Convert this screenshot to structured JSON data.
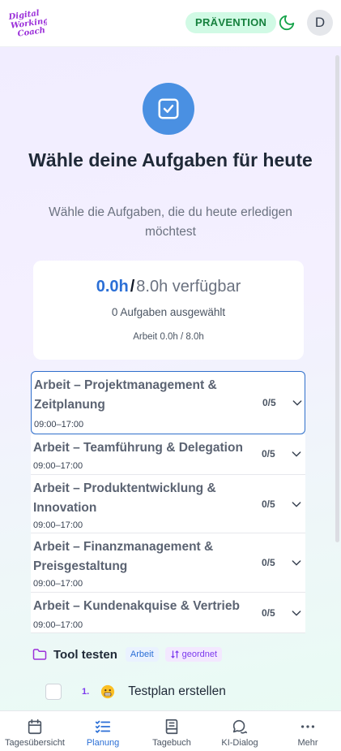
{
  "header": {
    "logo_text": [
      "Digital",
      "Working",
      "Coach"
    ],
    "mode_badge": "PRÄVENTION",
    "avatar_initial": "D"
  },
  "hero": {
    "title": "Wähle deine Aufgaben für heute",
    "subtitle": "Wähle die Aufgaben, die du heute erledigen möchtest"
  },
  "summary": {
    "used": "0.0h",
    "slash": "/",
    "available": "8.0h verfügbar",
    "selected": "0 Aufgaben ausgewählt",
    "budget": "Arbeit 0.0h / 8.0h"
  },
  "categories": [
    {
      "title": "Arbeit – Projektmanagement & Zeitplanung",
      "time": "09:00–17:00",
      "count": "0/5"
    },
    {
      "title": "Arbeit – Teamführung & Delegation",
      "time": "09:00–17:00",
      "count": "0/5"
    },
    {
      "title": "Arbeit – Produktentwicklung & Innovation",
      "time": "09:00–17:00",
      "count": "0/5"
    },
    {
      "title": "Arbeit – Finanzmanagement & Preisgestaltung",
      "time": "09:00–17:00",
      "count": "0/5"
    },
    {
      "title": "Arbeit – Kundenakquise & Vertrieb",
      "time": "09:00–17:00",
      "count": "0/5"
    }
  ],
  "project": {
    "name": "Tool testen",
    "tag": "Arbeit",
    "sort": "geordnet"
  },
  "tasks": [
    {
      "number": "1.",
      "name": "Testplan erstellen"
    }
  ],
  "nav": [
    {
      "label": "Tagesübersicht",
      "icon": "calendar-icon"
    },
    {
      "label": "Planung",
      "icon": "list-check-icon"
    },
    {
      "label": "Tagebuch",
      "icon": "book-icon"
    },
    {
      "label": "KI-Dialog",
      "icon": "chat-icon"
    },
    {
      "label": "Mehr",
      "icon": "more-icon"
    }
  ],
  "colors": {
    "accent": "#2b6fd6",
    "badge_bg": "#d1fae5",
    "badge_text": "#15803d",
    "logo": "#9b30d9",
    "tag_purple": "#7c3aed"
  }
}
